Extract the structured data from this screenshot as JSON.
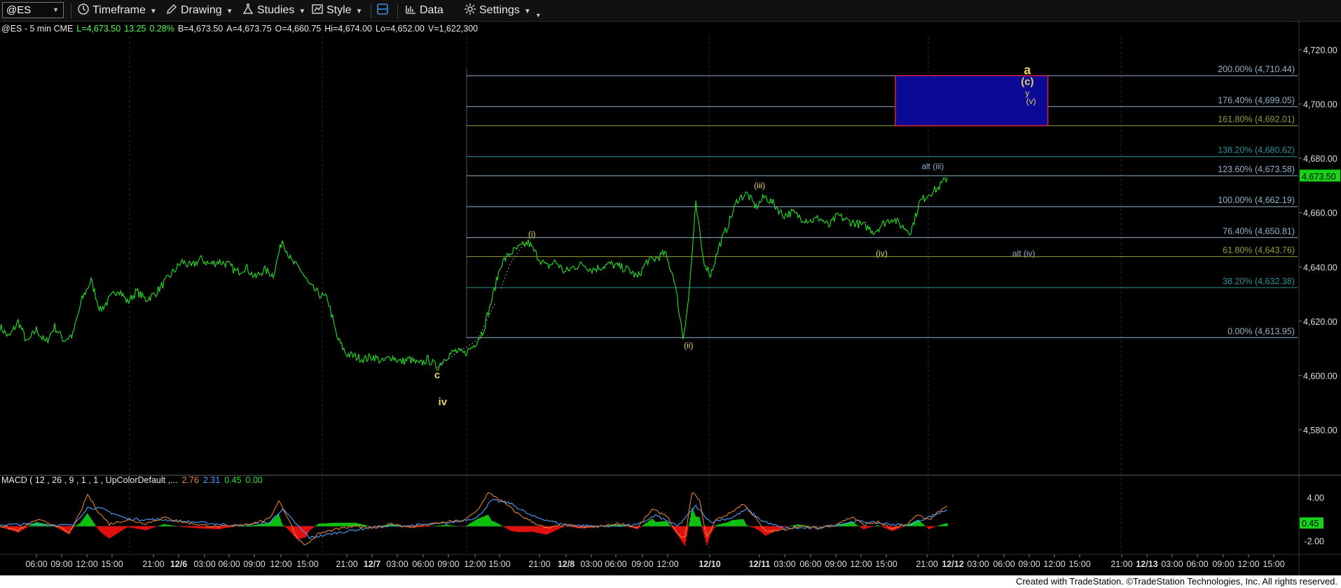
{
  "toolbar": {
    "symbol": "@ES",
    "timeframe": "Timeframe",
    "drawing": "Drawing",
    "studies": "Studies",
    "style": "Style",
    "data": "Data",
    "settings": "Settings"
  },
  "quote": {
    "prefix": "@ES - 5 min  CME",
    "last": "L=4,673.50",
    "change": "13.25",
    "pct": "0.28%",
    "bid": "B=4,673.50",
    "ask": "A=4,673.75",
    "open": "O=4,660.75",
    "high": "Hi=4,674.00",
    "low": "Lo=4,652.00",
    "volume": "V=1,622,300"
  },
  "macd_label": {
    "text": "MACD ( 12 , 26 , 9 , 1 , 1 , UpColorDefault ,...",
    "v1": "2.76",
    "v2": "2.31",
    "v3": "0.45",
    "v4": "0.00"
  },
  "footer": "Created with TradeStation. ©TradeStation Technologies, Inc. All rights reserved.",
  "colors": {
    "price": "#22e022",
    "fib_blue": "#8fb3c8",
    "fib_olive": "#9a9a3a",
    "fib_teal": "#2c8f96",
    "wave_label": "#e6d25a",
    "target_box": "#0a0a96",
    "target_border": "#d0243a",
    "last_price_bg": "#17d317",
    "macd_line": "#e08030",
    "signal_line": "#4aa0ff",
    "hist_pos": "#10c010",
    "hist_neg": "#e01010"
  },
  "chart_data": {
    "type": "line",
    "instrument": "@ES",
    "interval": "5 min",
    "ylim": [
      4564,
      4728
    ],
    "price_ticks": [
      "4,720.00",
      "4,700.00",
      "4,680.00",
      "4,660.00",
      "4,640.00",
      "4,620.00",
      "4,600.00",
      "4,580.00"
    ],
    "last_price_label": "4,673.50",
    "x_labels": [
      "06:00",
      "09:00",
      "12:00",
      "15:00",
      "21:00",
      "12/6",
      "03:00",
      "06:00",
      "09:00",
      "12:00",
      "15:00",
      "21:00",
      "12/7",
      "03:00",
      "06:00",
      "09:00",
      "12:00",
      "15:00",
      "21:00",
      "12/8",
      "03:00",
      "06:00",
      "09:00",
      "12:00",
      "12/10",
      "12/11",
      "03:00",
      "06:00",
      "09:00",
      "12:00",
      "15:00",
      "21:00",
      "12/12",
      "03:00",
      "06:00",
      "09:00",
      "12:00",
      "15:00",
      "21:00",
      "12/13",
      "03:00",
      "06:00",
      "09:00",
      "12:00",
      "15:00"
    ],
    "x_bold": [
      "12/6",
      "12/7",
      "12/8",
      "12/10",
      "12/11",
      "12/12",
      "12/13"
    ],
    "price_series": [
      [
        0,
        4618
      ],
      [
        5,
        4614
      ],
      [
        10,
        4620
      ],
      [
        15,
        4612
      ],
      [
        20,
        4617
      ],
      [
        25,
        4612
      ],
      [
        30,
        4618
      ],
      [
        35,
        4613
      ],
      [
        40,
        4615
      ],
      [
        45,
        4628
      ],
      [
        50,
        4635
      ],
      [
        55,
        4624
      ],
      [
        60,
        4628
      ],
      [
        65,
        4632
      ],
      [
        70,
        4627
      ],
      [
        75,
        4631
      ],
      [
        80,
        4628
      ],
      [
        85,
        4630
      ],
      [
        90,
        4634
      ],
      [
        95,
        4638
      ],
      [
        100,
        4642
      ],
      [
        105,
        4640
      ],
      [
        110,
        4643
      ],
      [
        115,
        4641
      ],
      [
        120,
        4642
      ],
      [
        125,
        4641
      ],
      [
        130,
        4638
      ],
      [
        135,
        4640
      ],
      [
        140,
        4636
      ],
      [
        145,
        4639
      ],
      [
        150,
        4637
      ],
      [
        155,
        4650
      ],
      [
        160,
        4642
      ],
      [
        165,
        4639
      ],
      [
        170,
        4633
      ],
      [
        175,
        4630
      ],
      [
        180,
        4628
      ],
      [
        185,
        4614
      ],
      [
        190,
        4608
      ],
      [
        195,
        4607
      ],
      [
        200,
        4606
      ],
      [
        205,
        4607
      ],
      [
        210,
        4605
      ],
      [
        215,
        4607
      ],
      [
        220,
        4605
      ],
      [
        225,
        4606
      ],
      [
        230,
        4604
      ],
      [
        235,
        4606
      ],
      [
        240,
        4603
      ],
      [
        245,
        4607
      ],
      [
        250,
        4609
      ],
      [
        255,
        4608
      ],
      [
        260,
        4611
      ],
      [
        265,
        4616
      ],
      [
        270,
        4628
      ],
      [
        275,
        4641
      ],
      [
        280,
        4645
      ],
      [
        285,
        4647
      ],
      [
        290,
        4649
      ],
      [
        295,
        4644
      ],
      [
        300,
        4640
      ],
      [
        305,
        4642
      ],
      [
        310,
        4638
      ],
      [
        315,
        4640
      ],
      [
        320,
        4641
      ],
      [
        325,
        4639
      ],
      [
        330,
        4640
      ],
      [
        335,
        4641
      ],
      [
        340,
        4640
      ],
      [
        345,
        4639
      ],
      [
        350,
        4636
      ],
      [
        355,
        4642
      ],
      [
        360,
        4643
      ],
      [
        365,
        4645
      ],
      [
        370,
        4636
      ],
      [
        375,
        4614
      ],
      [
        378,
        4628
      ],
      [
        382,
        4663
      ],
      [
        386,
        4643
      ],
      [
        390,
        4637
      ],
      [
        395,
        4648
      ],
      [
        400,
        4656
      ],
      [
        405,
        4665
      ],
      [
        410,
        4667
      ],
      [
        415,
        4662
      ],
      [
        420,
        4666
      ],
      [
        425,
        4663
      ],
      [
        430,
        4659
      ],
      [
        435,
        4660
      ],
      [
        440,
        4658
      ],
      [
        445,
        4657
      ],
      [
        450,
        4658
      ],
      [
        455,
        4655
      ],
      [
        460,
        4659
      ],
      [
        465,
        4657
      ],
      [
        470,
        4656
      ],
      [
        475,
        4655
      ],
      [
        480,
        4653
      ],
      [
        485,
        4656
      ],
      [
        490,
        4658
      ],
      [
        495,
        4655
      ],
      [
        500,
        4653
      ],
      [
        505,
        4664
      ],
      [
        510,
        4667
      ],
      [
        515,
        4669
      ],
      [
        520,
        4673
      ]
    ],
    "path_segments": [
      {
        "name": "ii-to-iv",
        "points": [
          [
            240,
            4603
          ],
          [
            250,
            4608
          ],
          [
            262,
            4613
          ],
          [
            272,
            4627
          ]
        ]
      },
      {
        "name": "iv-to-i",
        "points": [
          [
            275,
            4632
          ],
          [
            280,
            4641
          ],
          [
            288,
            4649
          ]
        ]
      }
    ],
    "fib_levels": [
      {
        "label": "200.00% (4,710.44)",
        "value": 4710.44,
        "color": "fib_blue"
      },
      {
        "label": "176.40% (4,699.05)",
        "value": 4699.05,
        "color": "fib_blue"
      },
      {
        "label": "161.80% (4,692.01)",
        "value": 4692.01,
        "color": "fib_olive"
      },
      {
        "label": "138.20% (4,680.62)",
        "value": 4680.62,
        "color": "fib_teal"
      },
      {
        "label": "123.60% (4,673.58)",
        "value": 4673.58,
        "color": "fib_blue"
      },
      {
        "label": "100.00% (4,662.19)",
        "value": 4662.19,
        "color": "fib_blue"
      },
      {
        "label": "76.40% (4,650.81)",
        "value": 4650.81,
        "color": "fib_blue"
      },
      {
        "label": "61.80% (4,643.76)",
        "value": 4643.76,
        "color": "fib_olive"
      },
      {
        "label": "38.20% (4,632.38)",
        "value": 4632.38,
        "color": "fib_teal"
      },
      {
        "label": "0.00% (4,613.95)",
        "value": 4613.95,
        "color": "fib_blue"
      }
    ],
    "target_zone": {
      "x_start": 530,
      "x_end": 620,
      "y_low": 4692.01,
      "y_high": 4710.44
    },
    "wave_labels": [
      {
        "text": "c",
        "x": 240,
        "y": 4599,
        "color": "wave_label"
      },
      {
        "text": "iv",
        "x": 243,
        "y": 4589,
        "color": "wave_label"
      },
      {
        "text": "(i)",
        "x": 292,
        "y": 4651,
        "color": "wave_label"
      },
      {
        "text": "(ii)",
        "x": 378,
        "y": 4610,
        "color": "wave_label"
      },
      {
        "text": "(iii)",
        "x": 417,
        "y": 4669,
        "color": "wave_label"
      },
      {
        "text": "(iv)",
        "x": 484,
        "y": 4644,
        "color": "wave_label"
      },
      {
        "text": "alt (iii)",
        "x": 512,
        "y": 4676,
        "color": "fib_blue"
      },
      {
        "text": "alt (iv)",
        "x": 562,
        "y": 4644,
        "color": "fib_blue"
      },
      {
        "text": "a",
        "x": 564,
        "y": 4711,
        "color": "wave_label"
      },
      {
        "text": "(c)",
        "x": 564,
        "y": 4707,
        "color": "wave_label"
      },
      {
        "text": "y",
        "x": 564,
        "y": 4703,
        "color": "wave_label"
      },
      {
        "text": "(v)",
        "x": 566,
        "y": 4700,
        "color": "wave_label"
      }
    ],
    "macd": {
      "ylim": [
        -3.5,
        5.5
      ],
      "ticks": [
        "4.00",
        "-2.00"
      ],
      "tick_values": [
        4.0,
        -2.0
      ],
      "last_label": "0.45",
      "macd_series": [
        [
          0,
          0.1
        ],
        [
          10,
          -0.6
        ],
        [
          20,
          0.9
        ],
        [
          30,
          0.2
        ],
        [
          38,
          -1.0
        ],
        [
          44,
          1.8
        ],
        [
          48,
          4.4
        ],
        [
          54,
          2.0
        ],
        [
          60,
          0.3
        ],
        [
          70,
          0.9
        ],
        [
          80,
          0.4
        ],
        [
          90,
          1.2
        ],
        [
          100,
          0.6
        ],
        [
          110,
          0.2
        ],
        [
          120,
          -0.1
        ],
        [
          130,
          0.1
        ],
        [
          140,
          0.5
        ],
        [
          148,
          1.0
        ],
        [
          153,
          3.6
        ],
        [
          158,
          1.2
        ],
        [
          163,
          -1.6
        ],
        [
          168,
          -2.6
        ],
        [
          175,
          -1.0
        ],
        [
          185,
          -0.4
        ],
        [
          195,
          0.0
        ],
        [
          205,
          -0.2
        ],
        [
          215,
          0.3
        ],
        [
          225,
          -0.1
        ],
        [
          235,
          0.2
        ],
        [
          245,
          0.6
        ],
        [
          255,
          0.8
        ],
        [
          262,
          2.2
        ],
        [
          268,
          4.6
        ],
        [
          272,
          4.1
        ],
        [
          278,
          3.0
        ],
        [
          284,
          1.8
        ],
        [
          290,
          0.9
        ],
        [
          300,
          -0.3
        ],
        [
          310,
          0.2
        ],
        [
          320,
          -0.2
        ],
        [
          330,
          0.0
        ],
        [
          340,
          0.4
        ],
        [
          350,
          -0.2
        ],
        [
          358,
          2.3
        ],
        [
          366,
          1.5
        ],
        [
          372,
          -1.2
        ],
        [
          376,
          -1.6
        ],
        [
          380,
          4.8
        ],
        [
          384,
          3.5
        ],
        [
          388,
          -1.5
        ],
        [
          393,
          0.9
        ],
        [
          400,
          1.7
        ],
        [
          408,
          3.1
        ],
        [
          414,
          1.4
        ],
        [
          420,
          -0.7
        ],
        [
          428,
          -0.6
        ],
        [
          438,
          0.0
        ],
        [
          448,
          -0.3
        ],
        [
          458,
          0.2
        ],
        [
          468,
          1.3
        ],
        [
          474,
          0.2
        ],
        [
          482,
          0.6
        ],
        [
          490,
          -0.4
        ],
        [
          498,
          0.3
        ],
        [
          504,
          1.6
        ],
        [
          510,
          0.9
        ],
        [
          515,
          1.9
        ],
        [
          520,
          2.76
        ]
      ],
      "signal_series": [
        [
          0,
          0.2
        ],
        [
          20,
          0.3
        ],
        [
          40,
          0.1
        ],
        [
          48,
          2.6
        ],
        [
          56,
          2.4
        ],
        [
          70,
          1.0
        ],
        [
          90,
          0.9
        ],
        [
          110,
          0.5
        ],
        [
          130,
          0.1
        ],
        [
          148,
          0.5
        ],
        [
          155,
          2.4
        ],
        [
          163,
          0.2
        ],
        [
          170,
          -1.6
        ],
        [
          185,
          -0.9
        ],
        [
          205,
          -0.1
        ],
        [
          225,
          0.1
        ],
        [
          245,
          0.4
        ],
        [
          262,
          1.2
        ],
        [
          270,
          3.6
        ],
        [
          280,
          3.2
        ],
        [
          292,
          1.4
        ],
        [
          310,
          0.2
        ],
        [
          330,
          0.0
        ],
        [
          350,
          0.2
        ],
        [
          360,
          1.5
        ],
        [
          372,
          0.0
        ],
        [
          382,
          2.8
        ],
        [
          390,
          0.6
        ],
        [
          402,
          1.2
        ],
        [
          410,
          2.4
        ],
        [
          418,
          0.8
        ],
        [
          430,
          -0.3
        ],
        [
          450,
          -0.2
        ],
        [
          470,
          0.7
        ],
        [
          484,
          0.4
        ],
        [
          498,
          0.1
        ],
        [
          508,
          1.1
        ],
        [
          520,
          2.31
        ]
      ]
    }
  }
}
